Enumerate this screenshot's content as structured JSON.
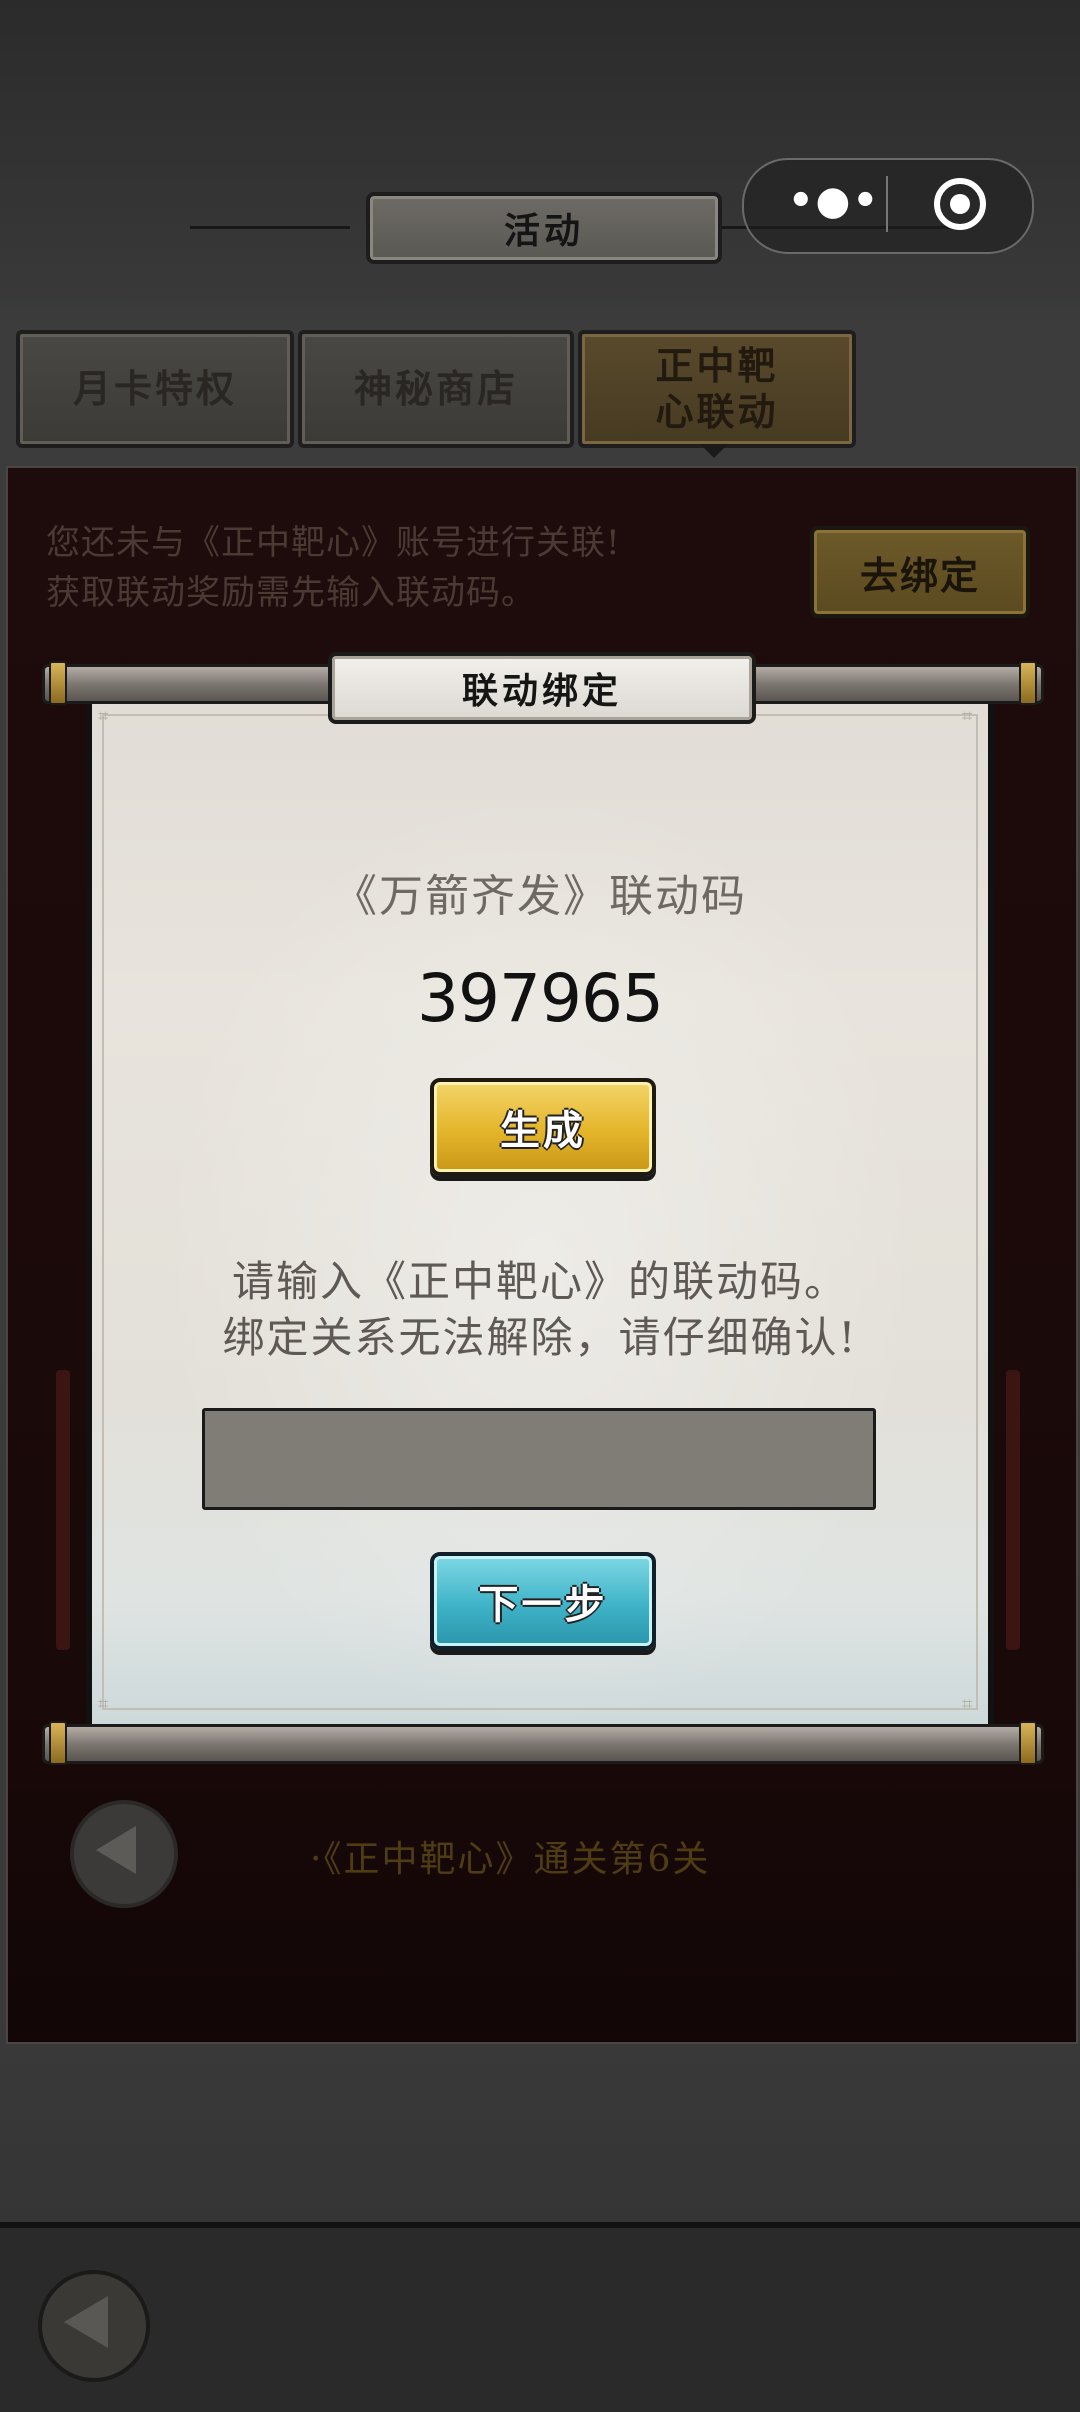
{
  "header": {
    "title": "活动",
    "capsule": {
      "more_icon": "more-dots-icon",
      "close_icon": "target-icon"
    }
  },
  "tabs": [
    {
      "label": "月卡特权",
      "active": false
    },
    {
      "label": "神秘商店",
      "active": false
    },
    {
      "label": "正中靶心联动",
      "active": true
    }
  ],
  "panel": {
    "message_line1": "您还未与《正中靶心》账号进行关联!",
    "message_line2": "获取联动奖励需先输入联动码。",
    "bind_button": "去绑定",
    "task": "·《正中靶心》通关第6关"
  },
  "modal": {
    "title": "联动绑定",
    "subtitle": "《万箭齐发》联动码",
    "code": "397965",
    "generate_button": "生成",
    "instruction_line1": "请输入《正中靶心》的联动码。",
    "instruction_line2": "绑定关系无法解除，请仔细确认!",
    "input_value": "",
    "next_button": "下一步"
  },
  "colors": {
    "accent_gold": "#e4b52a",
    "accent_teal": "#3fb3c8",
    "panel_bg": "#1e0b0b"
  }
}
